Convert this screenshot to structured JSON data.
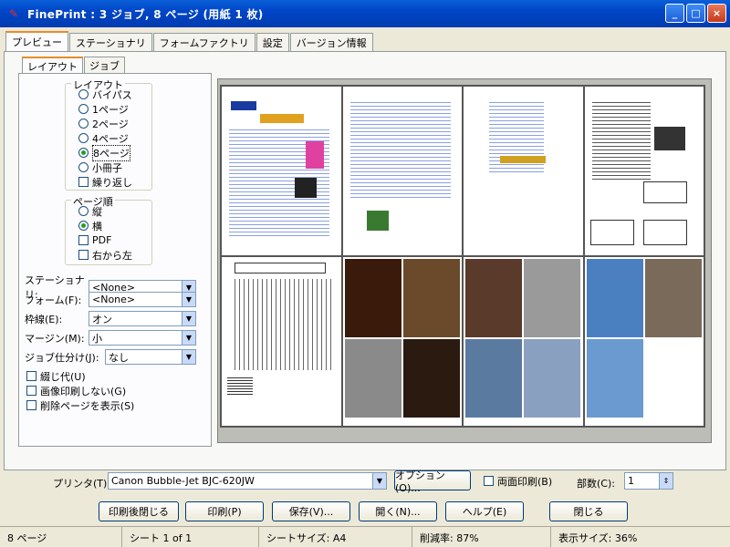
{
  "window": {
    "title": "FinePrint : 3 ジョブ, 8 ページ (用紙 1 枚)",
    "minimize": "_",
    "maximize": "□",
    "close": "×"
  },
  "tabs": [
    {
      "label": "プレビュー"
    },
    {
      "label": "ステーショナリ"
    },
    {
      "label": "フォームファクトリ"
    },
    {
      "label": "設定"
    },
    {
      "label": "バージョン情報"
    }
  ],
  "subtabs": [
    {
      "label": "レイアウト"
    },
    {
      "label": "ジョブ"
    }
  ],
  "layout": {
    "group_label": "レイアウト",
    "options": [
      "バイパス",
      "1ページ",
      "2ページ",
      "4ページ",
      "8ページ",
      "小冊子"
    ],
    "selected": "8ページ",
    "repeat_label": "繰り返し"
  },
  "order": {
    "group_label": "ページ順",
    "options": [
      "縦",
      "横"
    ],
    "selected": "横",
    "pdf_label": "PDF",
    "rtl_label": "右から左"
  },
  "fields": {
    "stationery": {
      "label": "ステーショナリ:",
      "value": "<None>"
    },
    "form": {
      "label": "フォーム(F):",
      "value": "<None>"
    },
    "border": {
      "label": "枠線(E):",
      "value": "オン"
    },
    "margin": {
      "label": "マージン(M):",
      "value": "小"
    },
    "finishing": {
      "label": "ジョブ仕分け(J):",
      "value": "なし"
    }
  },
  "checks": {
    "binding": "綴じ代(U)",
    "no_image": "画像印刷しない(G)",
    "show_deleted": "削除ページを表示(S)"
  },
  "printer": {
    "label": "プリンタ(T):",
    "value": "Canon Bubble-Jet BJC-620JW",
    "options_btn": "オプション(O)...",
    "duplex_label": "両面印刷(B)",
    "copies_label": "部数(C):",
    "copies": "1"
  },
  "buttons": {
    "close_after": "印刷後閉じる",
    "print": "印刷(P)",
    "save": "保存(V)...",
    "open": "開く(N)...",
    "help": "ヘルプ(E)",
    "close": "閉じる"
  },
  "status": {
    "pages": "8 ページ",
    "sheet": "シート 1 of 1",
    "sheet_size": "シートサイズ: A4",
    "reduction": "削減率: 87%",
    "display_size": "表示サイズ: 36%"
  },
  "colors": {
    "titlebar": "#0046c8",
    "accent_tab": "#e68b2c"
  }
}
